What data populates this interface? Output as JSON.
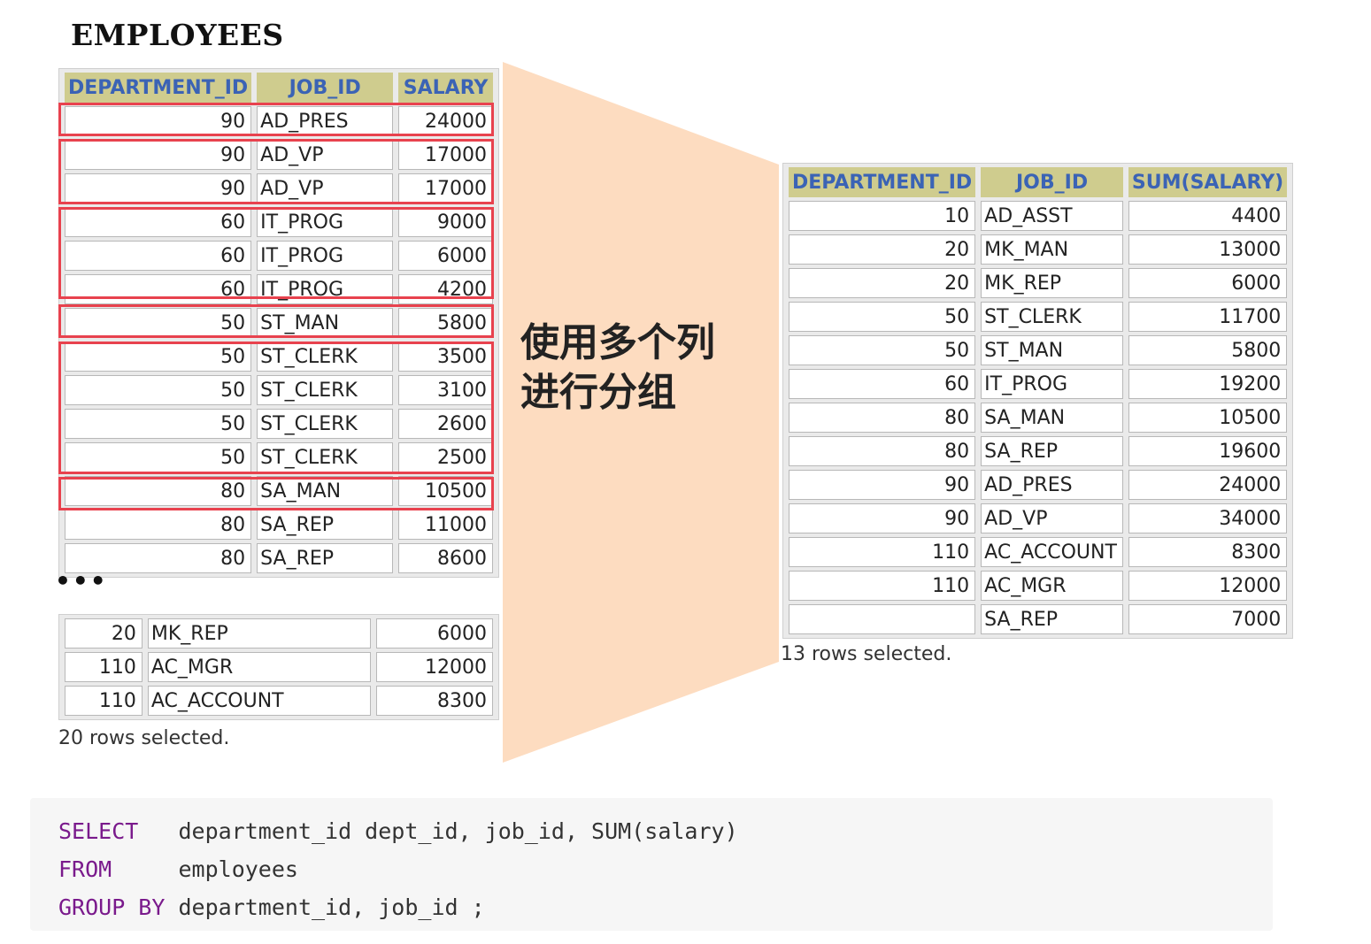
{
  "title": "EMPLOYEES",
  "employees": {
    "headers": [
      "DEPARTMENT_ID",
      "JOB_ID",
      "SALARY"
    ],
    "rows_top": [
      [
        "90",
        "AD_PRES",
        "24000"
      ],
      [
        "90",
        "AD_VP",
        "17000"
      ],
      [
        "90",
        "AD_VP",
        "17000"
      ],
      [
        "60",
        "IT_PROG",
        "9000"
      ],
      [
        "60",
        "IT_PROG",
        "6000"
      ],
      [
        "60",
        "IT_PROG",
        "4200"
      ],
      [
        "50",
        "ST_MAN",
        "5800"
      ],
      [
        "50",
        "ST_CLERK",
        "3500"
      ],
      [
        "50",
        "ST_CLERK",
        "3100"
      ],
      [
        "50",
        "ST_CLERK",
        "2600"
      ],
      [
        "50",
        "ST_CLERK",
        "2500"
      ],
      [
        "80",
        "SA_MAN",
        "10500"
      ],
      [
        "80",
        "SA_REP",
        "11000"
      ],
      [
        "80",
        "SA_REP",
        "8600"
      ]
    ],
    "ellipsis": "•••",
    "rows_bottom": [
      [
        "20",
        "MK_REP",
        "6000"
      ],
      [
        "110",
        "AC_MGR",
        "12000"
      ],
      [
        "110",
        "AC_ACCOUNT",
        "8300"
      ]
    ],
    "caption": "20 rows selected."
  },
  "middle_label": [
    "使用多个列",
    "进行分组"
  ],
  "result": {
    "headers": [
      "DEPARTMENT_ID",
      "JOB_ID",
      "SUM(SALARY)"
    ],
    "rows": [
      [
        "10",
        "AD_ASST",
        "4400"
      ],
      [
        "20",
        "MK_MAN",
        "13000"
      ],
      [
        "20",
        "MK_REP",
        "6000"
      ],
      [
        "50",
        "ST_CLERK",
        "11700"
      ],
      [
        "50",
        "ST_MAN",
        "5800"
      ],
      [
        "60",
        "IT_PROG",
        "19200"
      ],
      [
        "80",
        "SA_MAN",
        "10500"
      ],
      [
        "80",
        "SA_REP",
        "19600"
      ],
      [
        "90",
        "AD_PRES",
        "24000"
      ],
      [
        "90",
        "AD_VP",
        "34000"
      ],
      [
        "110",
        "AC_ACCOUNT",
        "8300"
      ],
      [
        "110",
        "AC_MGR",
        "12000"
      ],
      [
        "",
        "SA_REP",
        "7000"
      ]
    ],
    "caption": "13 rows selected."
  },
  "code": {
    "lines": [
      {
        "keyword": "SELECT",
        "pad": "   ",
        "text": "department_id dept_id, job_id, SUM(salary)"
      },
      {
        "keyword": "FROM",
        "pad": "     ",
        "text": "employees"
      },
      {
        "keyword": "GROUP BY",
        "pad": " ",
        "text": "department_id, job_id ;"
      }
    ]
  },
  "colors": {
    "header_bg": "#cfcc8e",
    "header_text": "#3b63b5",
    "highlight_box": "#e8424e",
    "funnel": "#fddcc0",
    "keyword": "#7a1a8c"
  }
}
